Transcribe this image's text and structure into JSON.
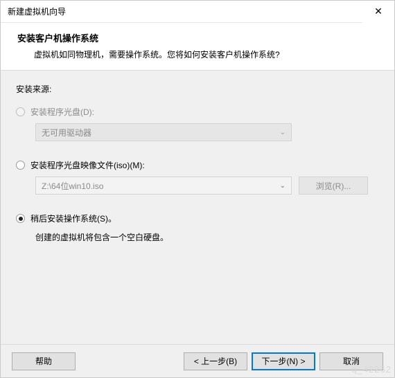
{
  "window": {
    "title": "新建虚拟机向导",
    "close_glyph": "✕"
  },
  "header": {
    "title": "安装客户机操作系统",
    "desc": "虚拟机如同物理机，需要操作系统。您将如何安装客户机操作系统?"
  },
  "section_label": "安装来源:",
  "options": {
    "disc": {
      "label": "安装程序光盘(D):",
      "combo_text": "无可用驱动器",
      "chev": "⌄"
    },
    "iso": {
      "label": "安装程序光盘映像文件(iso)(M):",
      "path": "Z:\\64位win10.iso",
      "chev": "⌄",
      "browse": "浏览(R)..."
    },
    "later": {
      "label": "稍后安装操作系统(S)。",
      "hint": "创建的虚拟机将包含一个空白硬盘。"
    }
  },
  "footer": {
    "help": "帮助",
    "back": "< 上一步(B)",
    "next": "下一步(N) >",
    "cancel": "取消"
  },
  "watermark": "q_42262"
}
